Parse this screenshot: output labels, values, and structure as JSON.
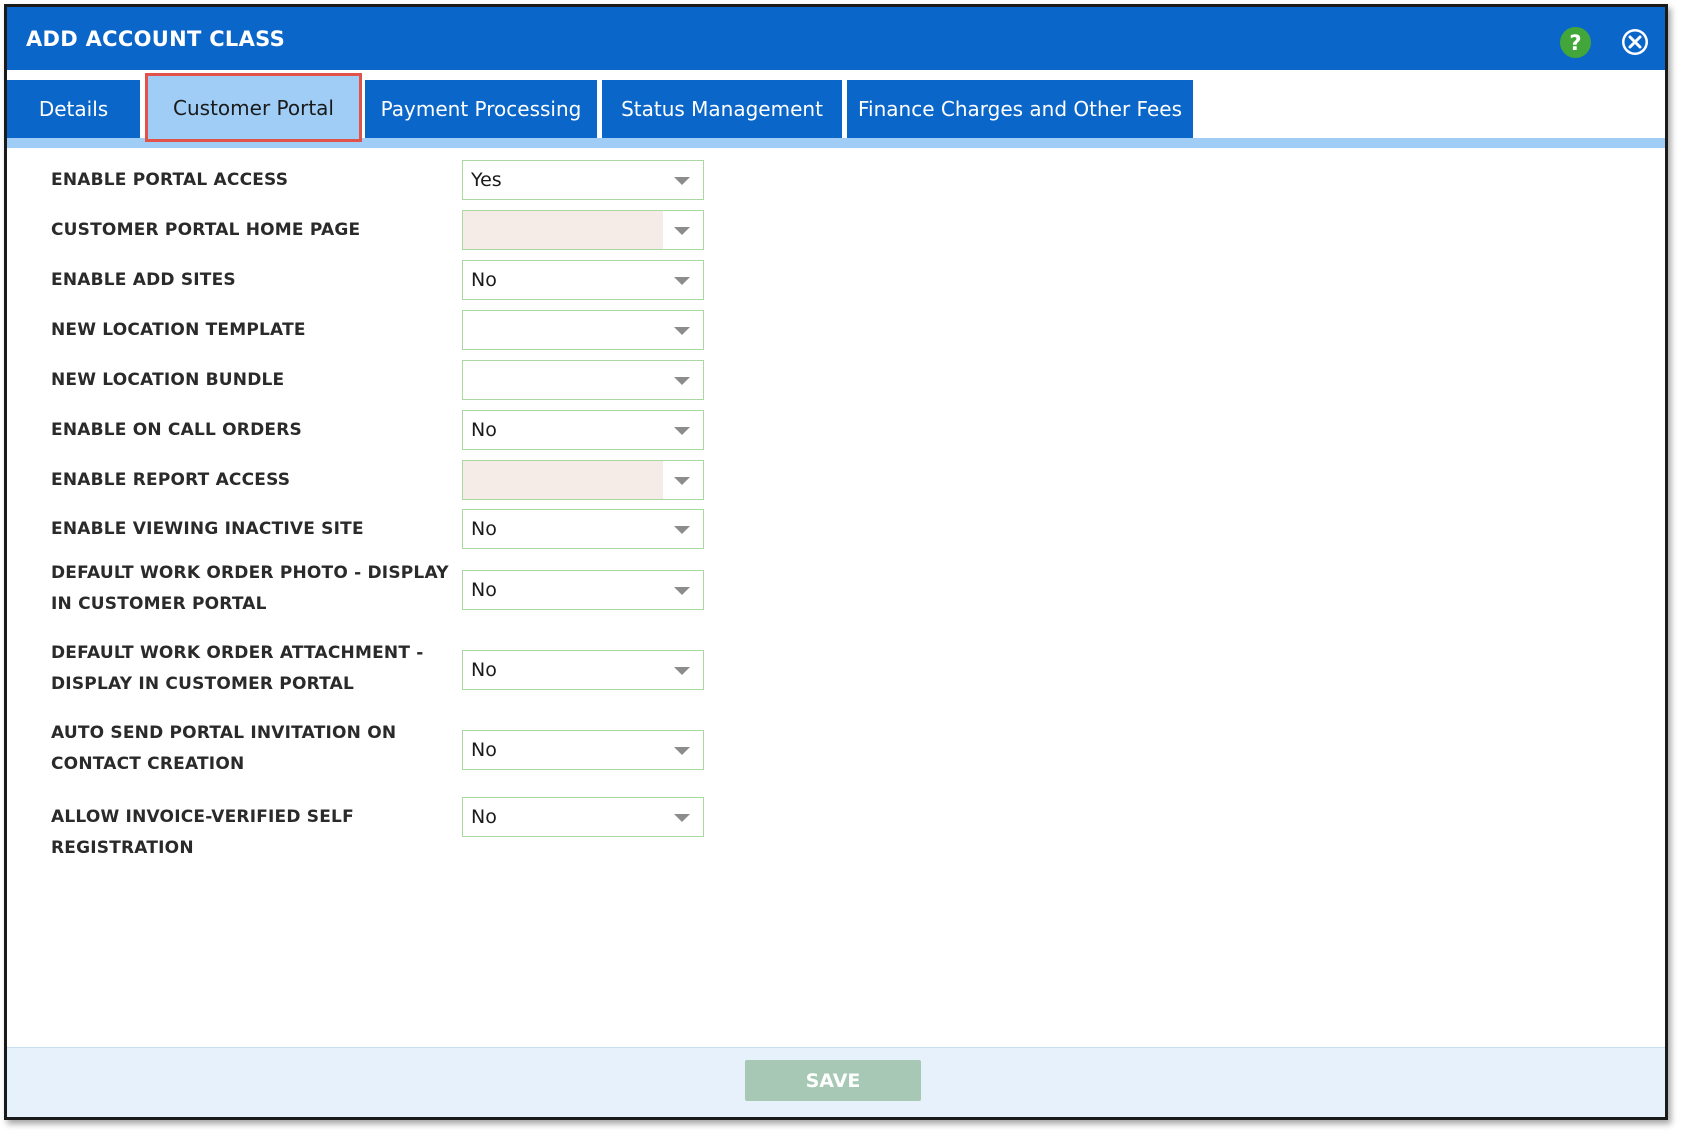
{
  "dialog": {
    "title": "ADD ACCOUNT CLASS",
    "help_icon": "question-mark-icon",
    "help_glyph": "?",
    "close_icon": "close-icon",
    "accent_color": "#0a66c8"
  },
  "tabs": [
    {
      "label": "Details",
      "active": false
    },
    {
      "label": "Customer Portal",
      "active": true
    },
    {
      "label": "Payment Processing",
      "active": false
    },
    {
      "label": "Status Management",
      "active": false
    },
    {
      "label": "Finance Charges and Other Fees",
      "active": false
    }
  ],
  "fields": [
    {
      "label": "ENABLE PORTAL ACCESS",
      "value": "Yes",
      "disabled": false
    },
    {
      "label": "CUSTOMER PORTAL HOME PAGE",
      "value": "",
      "disabled": true
    },
    {
      "label": "ENABLE ADD SITES",
      "value": "No",
      "disabled": false
    },
    {
      "label": "NEW LOCATION TEMPLATE",
      "value": "",
      "disabled": false
    },
    {
      "label": "NEW LOCATION BUNDLE",
      "value": "",
      "disabled": false
    },
    {
      "label": "ENABLE ON CALL ORDERS",
      "value": "No",
      "disabled": false
    },
    {
      "label": "ENABLE REPORT ACCESS",
      "value": "",
      "disabled": true
    },
    {
      "label": "ENABLE VIEWING INACTIVE SITE",
      "value": "No",
      "disabled": false
    },
    {
      "label": "DEFAULT WORK ORDER PHOTO - DISPLAY IN CUSTOMER PORTAL",
      "value": "No",
      "disabled": false
    },
    {
      "label": "DEFAULT WORK ORDER ATTACHMENT - DISPLAY IN CUSTOMER PORTAL",
      "value": "No",
      "disabled": false
    },
    {
      "label": "AUTO SEND PORTAL INVITATION ON CONTACT CREATION",
      "value": "No",
      "disabled": false
    },
    {
      "label": "ALLOW INVOICE-VERIFIED SELF REGISTRATION",
      "value": "No",
      "disabled": false
    }
  ],
  "footer": {
    "save_label": "SAVE"
  }
}
